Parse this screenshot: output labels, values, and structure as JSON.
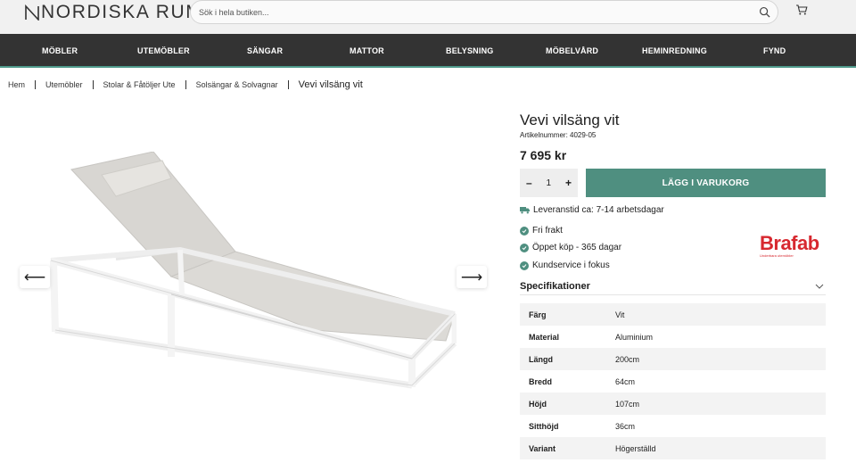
{
  "header": {
    "logo_text": "NORDISKA RUM",
    "search_placeholder": "Sök i hela butiken..."
  },
  "nav": {
    "items": [
      "MÖBLER",
      "UTEMÖBLER",
      "SÄNGAR",
      "MATTOR",
      "BELYSNING",
      "MÖBELVÅRD",
      "HEMINREDNING",
      "FYND"
    ]
  },
  "breadcrumb": {
    "items": [
      "Hem",
      "Utemöbler",
      "Stolar & Fåtöljer Ute",
      "Solsängar & Solvagnar"
    ],
    "current": "Vevi vilsäng vit"
  },
  "gallery": {
    "prev_label": "⟵",
    "next_label": "⟶"
  },
  "product": {
    "title": "Vevi vilsäng vit",
    "sku": "Artikelnummer: 4029-05",
    "price": "7 695 kr",
    "quantity": "1",
    "minus_label": "–",
    "plus_label": "+",
    "add_to_cart_label": "LÄGG I VARUKORG",
    "delivery": "Leveranstid ca: 7-14 arbetsdagar",
    "usps": [
      "Fri frakt",
      "Öppet köp - 365 dagar",
      "Kundservice i fokus"
    ],
    "brand": "Brafab",
    "brand_tagline": "Underbara utemöbler"
  },
  "specs": {
    "heading": "Specifikationer",
    "rows": [
      {
        "key": "Färg",
        "value": "Vit"
      },
      {
        "key": "Material",
        "value": "Aluminium"
      },
      {
        "key": "Längd",
        "value": "200cm"
      },
      {
        "key": "Bredd",
        "value": "64cm"
      },
      {
        "key": "Höjd",
        "value": "107cm"
      },
      {
        "key": "Sitthöjd",
        "value": "36cm"
      },
      {
        "key": "Variant",
        "value": "Högerställd"
      }
    ]
  },
  "colors": {
    "accent": "#4f8f80",
    "nav_bg": "#333333",
    "brand": "#d7282f"
  }
}
